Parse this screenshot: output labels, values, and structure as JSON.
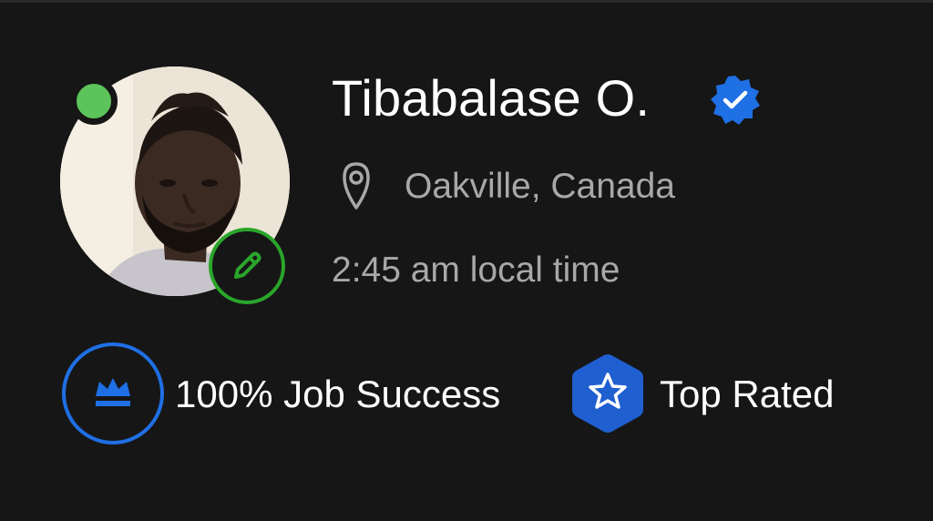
{
  "profile": {
    "name": "Tibabalase O.",
    "location": "Oakville, Canada",
    "local_time": "2:45 am local time",
    "online_status_color": "#5cc45a",
    "verified_color": "#1f6fe5"
  },
  "badges": [
    {
      "label": "100% Job Success",
      "icon": "crown-icon",
      "color": "#1f6fe5"
    },
    {
      "label": "Top Rated",
      "icon": "star-hexagon-icon",
      "color": "#1f5fcf"
    }
  ],
  "icons": {
    "edit": "pencil-icon",
    "location": "map-pin-icon",
    "verified": "verified-badge-icon"
  },
  "accent_colors": {
    "edit_ring": "#2aa52a",
    "text_primary": "#ffffff",
    "text_secondary": "#a8a8a8",
    "background": "#161616"
  }
}
